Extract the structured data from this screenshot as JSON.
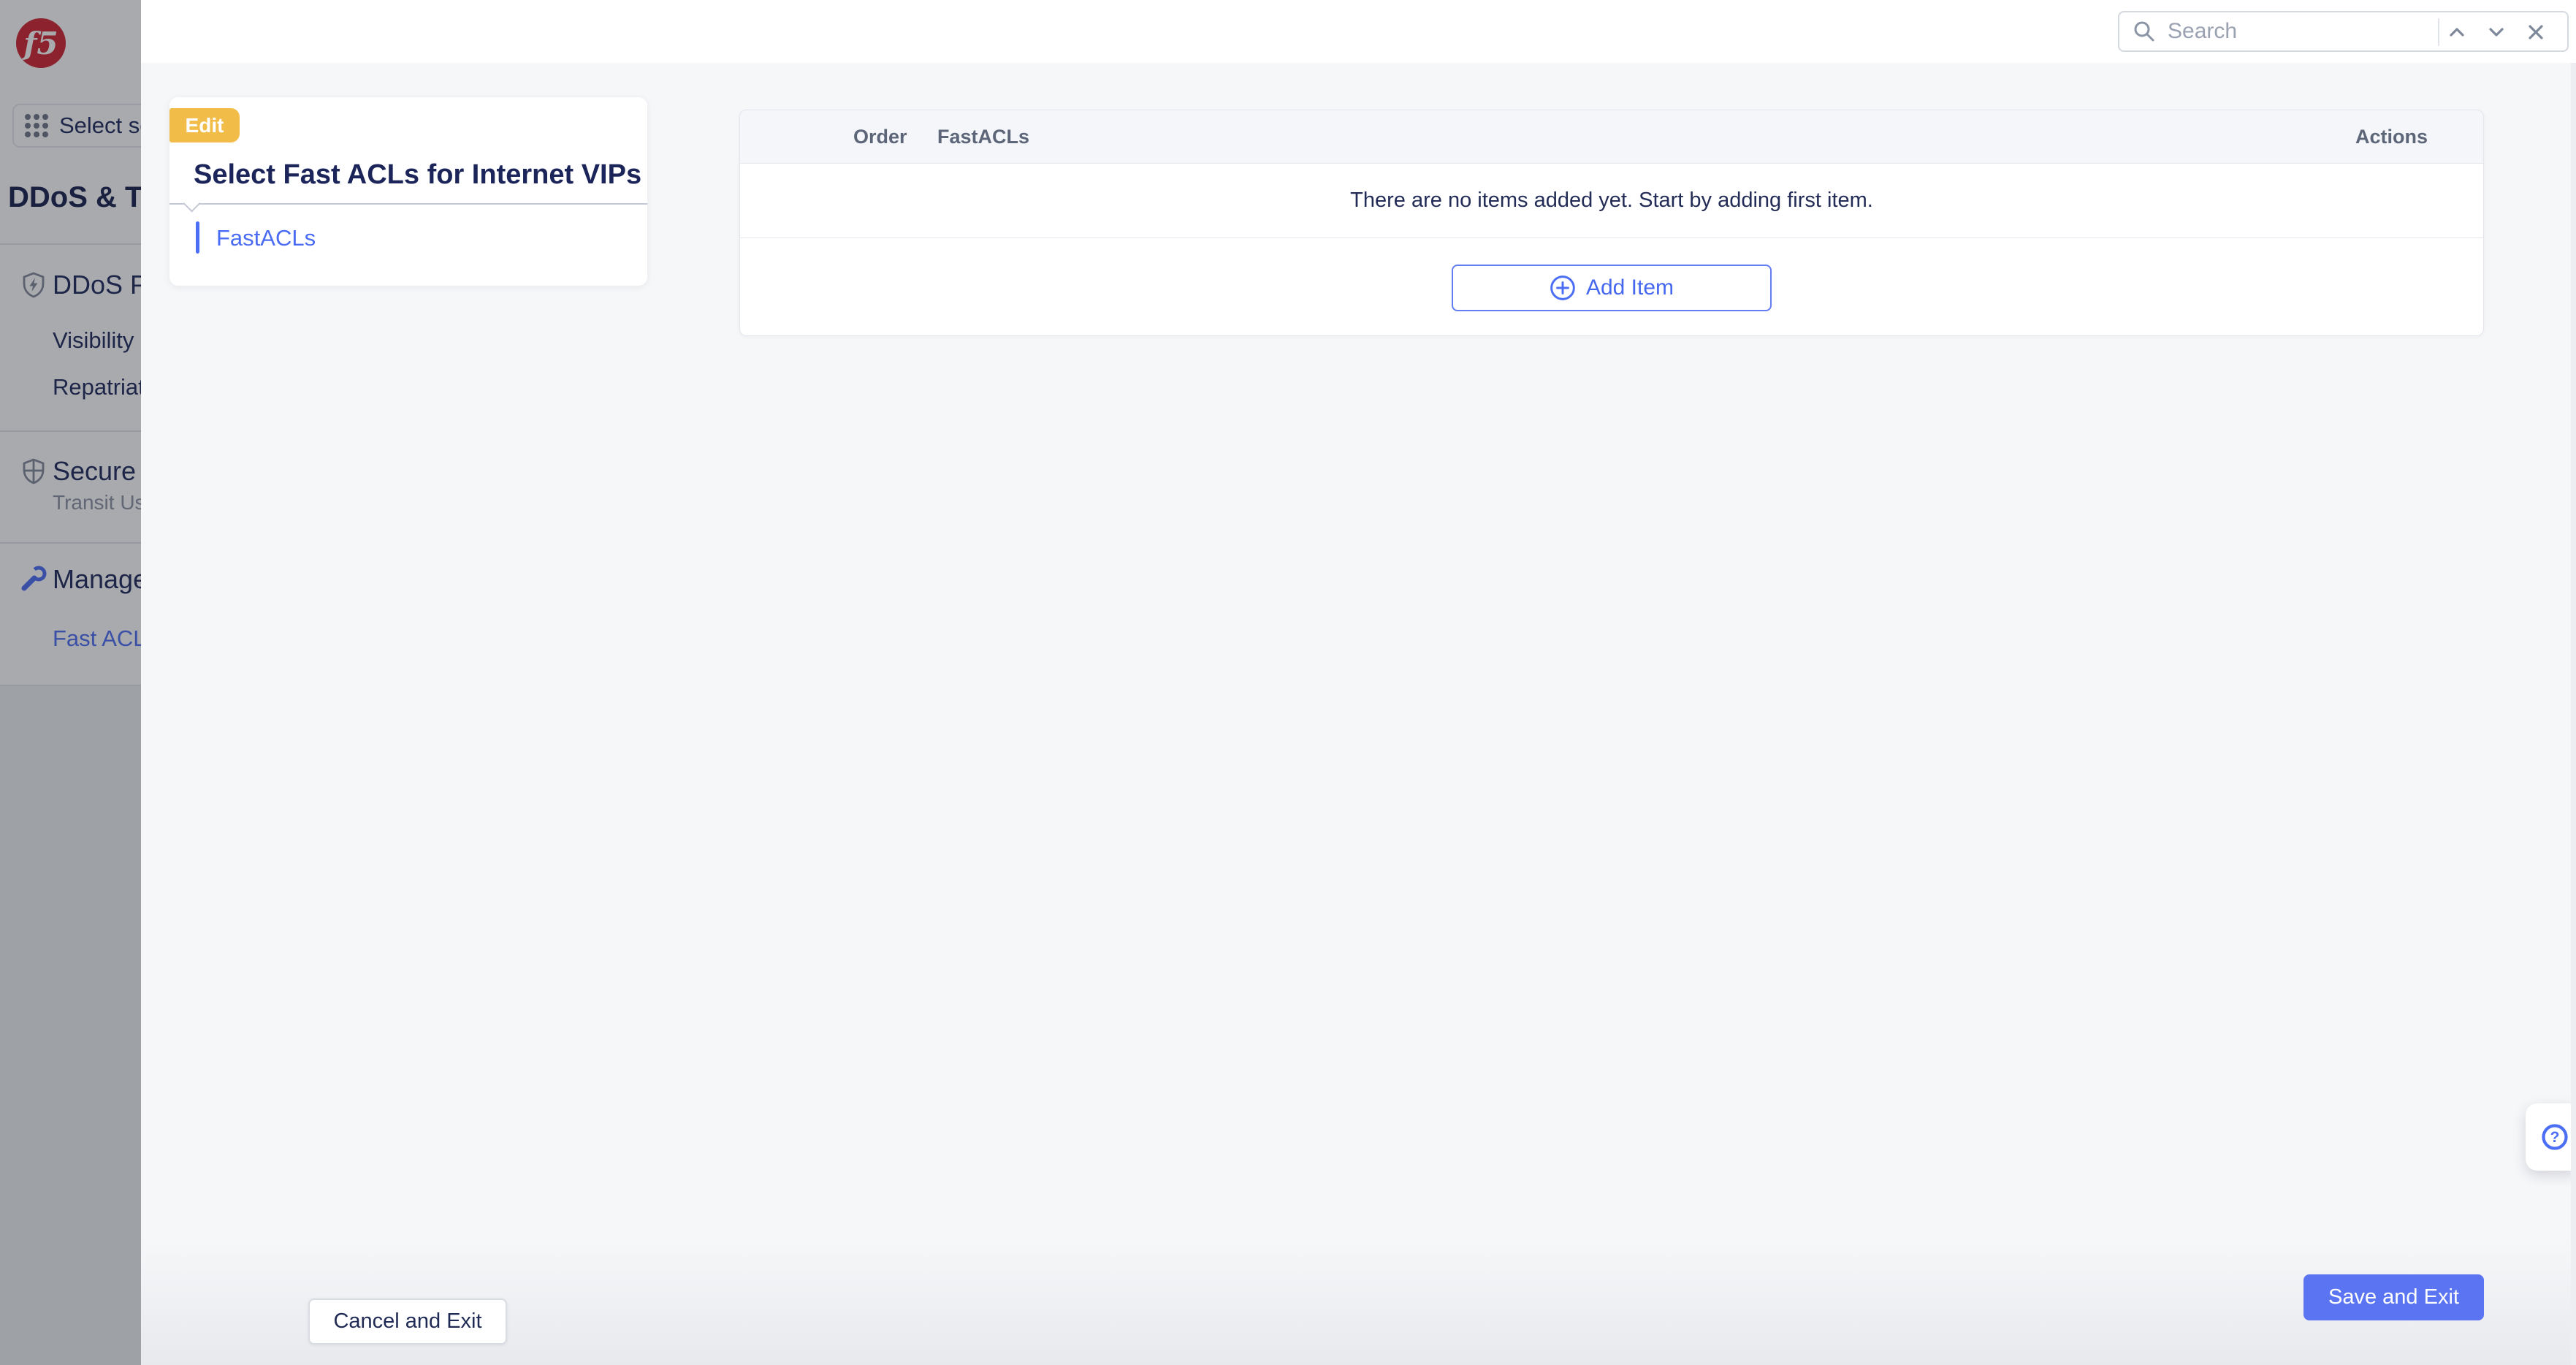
{
  "brand": {
    "logo_text": "f5"
  },
  "sidebar": {
    "app_switcher_label": "Select se",
    "service_title": "DDoS & Tra",
    "sections": {
      "ddos": {
        "title": "DDoS Pr",
        "items": [
          "Visibility",
          "Repatriat"
        ]
      },
      "secure": {
        "title": "Secure",
        "subtitle": "Transit Us"
      },
      "manage": {
        "title": "Manage",
        "items": [
          "Fast ACL"
        ]
      }
    }
  },
  "topbar": {
    "search_placeholder": "Search"
  },
  "panel": {
    "badge": "Edit",
    "title": "Select Fast ACLs for Internet VIPs",
    "step_label": "FastACLs"
  },
  "table": {
    "columns": {
      "order": "Order",
      "fastacls": "FastACLs",
      "actions": "Actions"
    },
    "empty_message": "There are no items added yet. Start by adding first item.",
    "add_item_label": "Add Item"
  },
  "footer": {
    "cancel_label": "Cancel and Exit",
    "save_label": "Save and Exit"
  },
  "colors": {
    "accent_blue": "#4c6ef5",
    "primary_button": "#5b74f2",
    "badge_yellow": "#f2bc49",
    "brand_red": "#cf2433",
    "overlay_dim": "rgba(28,31,39,0.38)"
  }
}
